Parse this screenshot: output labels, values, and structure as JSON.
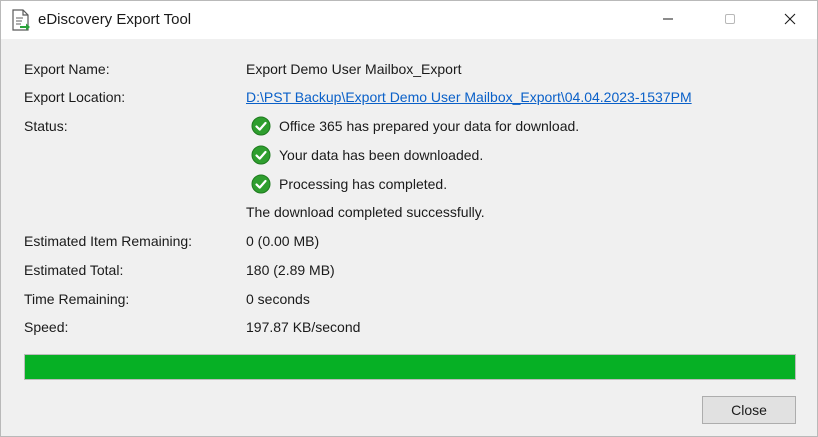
{
  "window": {
    "title": "eDiscovery Export Tool"
  },
  "fields": {
    "export_name": {
      "label": "Export Name:",
      "value": "Export Demo User Mailbox_Export"
    },
    "export_location": {
      "label": "Export Location:",
      "value": "D:\\PST Backup\\Export Demo User Mailbox_Export\\04.04.2023-1537PM"
    },
    "status": {
      "label": "Status:",
      "lines": [
        "Office 365 has prepared your data for download.",
        "Your data has been downloaded.",
        "Processing has completed."
      ],
      "summary": "The download completed successfully."
    },
    "estimated_item_remaining": {
      "label": "Estimated Item Remaining:",
      "value": "0 (0.00 MB)"
    },
    "estimated_total": {
      "label": "Estimated Total:",
      "value": "180 (2.89 MB)"
    },
    "time_remaining": {
      "label": "Time Remaining:",
      "value": "0 seconds"
    },
    "speed": {
      "label": "Speed:",
      "value": "197.87 KB/second"
    }
  },
  "progress": {
    "percent": 100,
    "color": "#06b025"
  },
  "buttons": {
    "close_label": "Close"
  },
  "icons": {
    "app": "export-tool-icon",
    "status_check": "green-check-icon"
  }
}
